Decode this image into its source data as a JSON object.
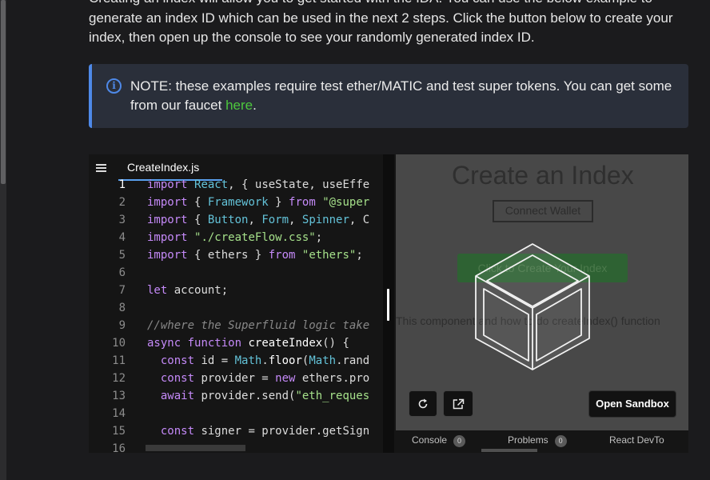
{
  "intro_lines": [
    "Creating an index will allow you to get started with the IDA. You can use the below example to",
    "generate an index ID which can be used in the next 2 steps. Click the button below to create your",
    "index, then open up the console to see your randomly generated index ID."
  ],
  "note": {
    "icon": "info-icon",
    "text_before": "NOTE: these examples require test ether/MATIC and test super tokens. You can get some from our faucet ",
    "link": "here",
    "text_after": ".",
    "accent_color": "#4e89e8"
  },
  "editor": {
    "tab": "CreateIndex.js",
    "lines": [
      {
        "n": "1",
        "t": "import React, { useState, useEffe"
      },
      {
        "n": "2",
        "t": "import { Framework } from \"@super"
      },
      {
        "n": "3",
        "t": "import { Button, Form, Spinner, C"
      },
      {
        "n": "4",
        "t": "import \"./createFlow.css\";"
      },
      {
        "n": "5",
        "t": "import { ethers } from \"ethers\";"
      },
      {
        "n": "6",
        "t": ""
      },
      {
        "n": "7",
        "t": "let account;"
      },
      {
        "n": "8",
        "t": ""
      },
      {
        "n": "9",
        "t": "//where the Superfluid logic take"
      },
      {
        "n": "10",
        "t": "async function createIndex() {"
      },
      {
        "n": "11",
        "t": "  const id = Math.floor(Math.rand"
      },
      {
        "n": "12",
        "t": "  const provider = new ethers.pro"
      },
      {
        "n": "13",
        "t": "  await provider.send(\"eth_reques"
      },
      {
        "n": "14",
        "t": ""
      },
      {
        "n": "15",
        "t": "  const signer = provider.getSign"
      },
      {
        "n": "16",
        "t": ""
      }
    ]
  },
  "preview": {
    "title": "Create an Index",
    "connect": "Connect Wallet",
    "create": "Click to Create Your Index",
    "desc": "This component and how to do createIndex() function"
  },
  "toolbar": {
    "refresh": "refresh-icon",
    "open_new": "open-in-new-window-icon",
    "open_sandbox": "Open Sandbox"
  },
  "bottom": {
    "console": "Console",
    "console_count": "0",
    "problems": "Problems",
    "problems_count": "0",
    "devtools": "React DevTo"
  }
}
